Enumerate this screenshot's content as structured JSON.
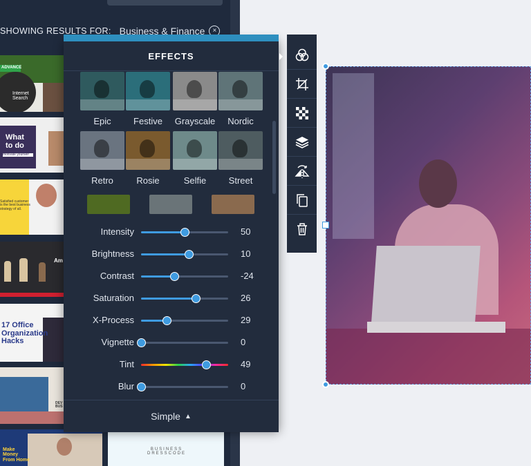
{
  "results": {
    "label": "SHOWING RESULTS FOR:",
    "query": "Business & Finance",
    "clear_symbol": "×"
  },
  "thumbnails": [
    {
      "text": "ADVANCE",
      "sub": "Internet Search"
    },
    {
      "text": "What to do",
      "sub": "motivate yourself"
    },
    {
      "text": "Satisfied customer is the best business strategy of all."
    },
    {
      "text": "Am"
    },
    {
      "text": "17 Office Organization Hacks"
    },
    {
      "text": "DEV BUS"
    },
    {
      "text": "Make Money From Home"
    },
    {
      "text": "BUSINESS DRESSCODE"
    }
  ],
  "panel": {
    "title": "EFFECTS",
    "effects": [
      {
        "name": "Epic",
        "color": "#2f5a5e"
      },
      {
        "name": "Festive",
        "color": "#2b6e7a"
      },
      {
        "name": "Grayscale",
        "color": "#8a8a8a"
      },
      {
        "name": "Nordic",
        "color": "#5f7478"
      },
      {
        "name": "Retro",
        "color": "#6a7480"
      },
      {
        "name": "Rosie",
        "color": "#7a5a2e"
      },
      {
        "name": "Selfie",
        "color": "#6e8a8a"
      },
      {
        "name": "Street",
        "color": "#4e5c60"
      }
    ],
    "extra_effects": [
      "#4f6a22",
      "#6a7478",
      "#8a6a4e"
    ],
    "adjustments": [
      {
        "name": "Intensity",
        "value": 50,
        "min": 0,
        "max": 100
      },
      {
        "name": "Brightness",
        "value": 10,
        "min": -100,
        "max": 100
      },
      {
        "name": "Contrast",
        "value": -24,
        "min": -100,
        "max": 100
      },
      {
        "name": "Saturation",
        "value": 26,
        "min": -100,
        "max": 100
      },
      {
        "name": "X-Process",
        "value": 29,
        "min": 0,
        "max": 100
      },
      {
        "name": "Vignette",
        "value": 0,
        "min": 0,
        "max": 100
      },
      {
        "name": "Tint",
        "value": 49,
        "min": -100,
        "max": 100
      },
      {
        "name": "Blur",
        "value": 0,
        "min": 0,
        "max": 100
      }
    ],
    "footer_label": "Simple"
  },
  "tools": [
    "effects-icon",
    "crop-icon",
    "transparency-icon",
    "layers-icon",
    "flip-icon",
    "duplicate-icon",
    "delete-icon"
  ],
  "colors": {
    "accent": "#3f9be0",
    "panel": "#222c3d"
  }
}
